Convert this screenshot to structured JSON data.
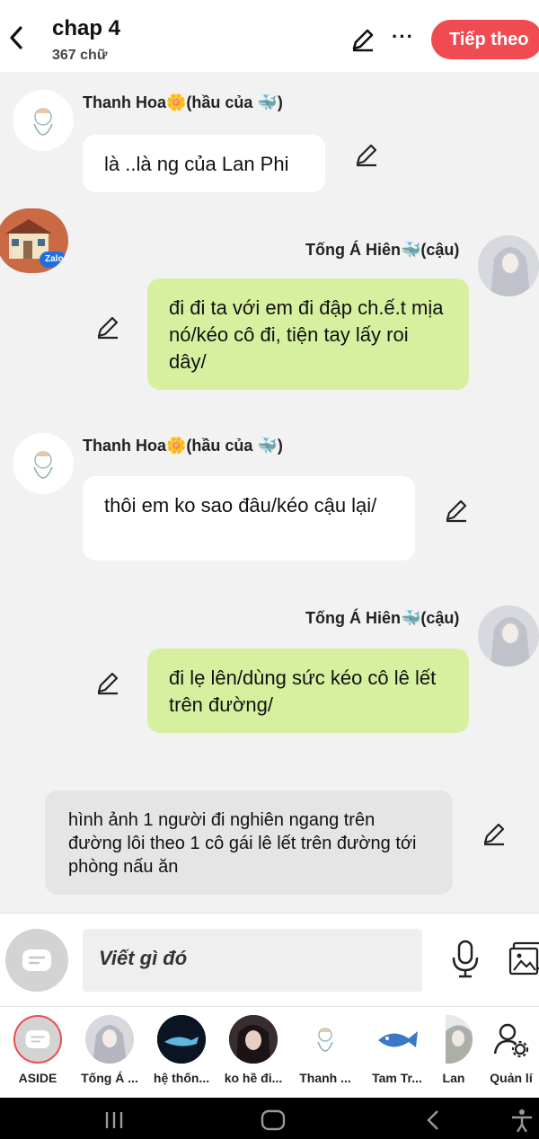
{
  "header": {
    "title": "chap 4",
    "subtitle": "367 chữ",
    "next_label": "Tiếp theo"
  },
  "messages": [
    {
      "side": "left",
      "name": "Thanh Hoa🌼(hầu của 🐳)",
      "text": "là ..là ng của Lan Phi"
    },
    {
      "side": "right",
      "name": "Tống Á Hiên🐳(cậu)",
      "text": "đi đi ta với em đi đập ch.ế.t mịa nó/kéo cô đi, tiện tay lấy roi dây/"
    },
    {
      "side": "left",
      "name": "Thanh Hoa🌼(hầu của 🐳)",
      "text": "thôi em ko sao đâu/kéo cậu lại/"
    },
    {
      "side": "right",
      "name": "Tống Á Hiên🐳(cậu)",
      "text": "đi lẹ lên/dùng sức kéo cô lê lết trên đường/"
    },
    {
      "side": "narration",
      "text": "hình ảnh 1 người đi nghiên ngang trên đường lôi theo 1 cô gái lê lết trên đường tới phòng nấu ăn"
    }
  ],
  "input": {
    "placeholder": "Viết gì đó"
  },
  "zalo_label": "Zalo",
  "characters": [
    {
      "label": "ASIDE",
      "icon": "aside-icon"
    },
    {
      "label": "Tống Á ...",
      "icon": "avatar-tong-a-hien"
    },
    {
      "label": "hệ thốn...",
      "icon": "avatar-he-thong"
    },
    {
      "label": "ko hề đi...",
      "icon": "avatar-ko-he-di"
    },
    {
      "label": "Thanh ...",
      "icon": "avatar-thanh-hoa"
    },
    {
      "label": "Tam Tr...",
      "icon": "avatar-tam-tr"
    },
    {
      "label": "Lan",
      "icon": "avatar-lan"
    },
    {
      "label": "Quản lí",
      "icon": "manage-user-icon"
    }
  ],
  "colors": {
    "accent": "#f04a52",
    "bubble_right": "#d7f0a0",
    "bubble_left": "#ffffff",
    "narration": "#e5e5e5"
  }
}
